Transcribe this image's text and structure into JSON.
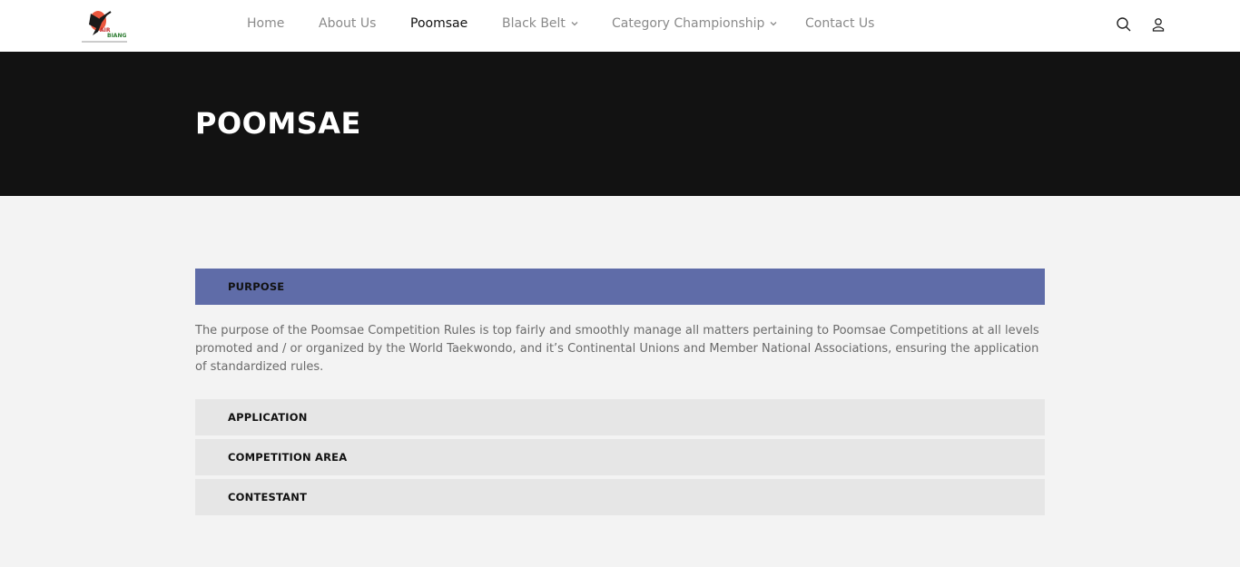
{
  "brand": {
    "logo_text": "AIR BIANG",
    "logo_subtext": "TAEKWONDO ASSOCIATION"
  },
  "nav": {
    "items": [
      {
        "label": "Home",
        "has_dropdown": false,
        "active": false
      },
      {
        "label": "About Us",
        "has_dropdown": false,
        "active": false
      },
      {
        "label": "Poomsae",
        "has_dropdown": false,
        "active": true
      },
      {
        "label": "Black Belt",
        "has_dropdown": true,
        "active": false
      },
      {
        "label": "Category Championship",
        "has_dropdown": true,
        "active": false
      },
      {
        "label": "Contact Us",
        "has_dropdown": false,
        "active": false
      }
    ]
  },
  "header_icons": [
    "search-icon",
    "user-icon"
  ],
  "hero": {
    "title": "POOMSAE"
  },
  "accordion": {
    "sections": [
      {
        "title": "PURPOSE",
        "open": true,
        "body": "The purpose of the Poomsae Competition Rules is top fairly and smoothly manage all matters pertaining to Poomsae Competitions at all levels promoted and / or organized by the World Taekwondo, and it’s Continental Unions and Member National Associations, ensuring the application of standardized rules."
      },
      {
        "title": "APPLICATION",
        "open": false
      },
      {
        "title": "COMPETITION AREA",
        "open": false
      },
      {
        "title": "CONTESTANT",
        "open": false
      }
    ]
  },
  "colors": {
    "accent": "#5f6ca8",
    "hero_bg": "#121212",
    "page_bg": "#f3f3f3",
    "collapsed_bg": "#e6e6e6"
  }
}
